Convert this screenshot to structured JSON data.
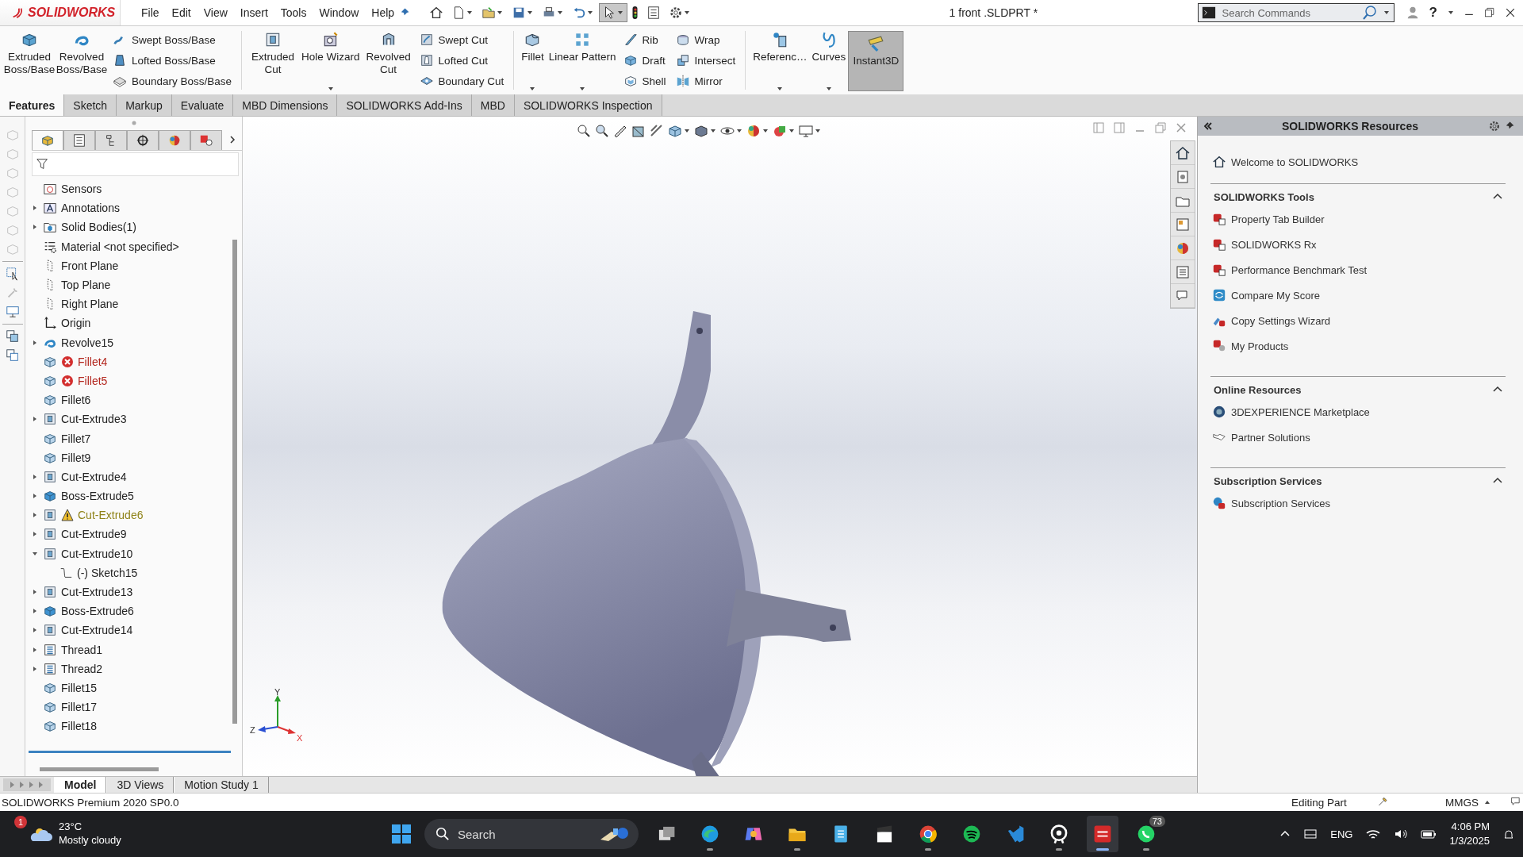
{
  "title_bar": {
    "logo": "SOLIDWORKS",
    "menu": [
      "File",
      "Edit",
      "View",
      "Insert",
      "Tools",
      "Window",
      "Help"
    ],
    "quick_access": [
      {
        "selected": false
      },
      {
        "selected": false
      },
      {
        "selected": false
      },
      {
        "selected": false
      },
      {
        "selected": false
      },
      {
        "selected": false
      },
      {
        "selected": true
      },
      {
        "selected": false
      },
      {
        "selected": false
      },
      {
        "selected": false
      }
    ],
    "document_title": "1 front .SLDPRT *",
    "search": {
      "placeholder": "Search Commands"
    },
    "help": "?"
  },
  "ribbon": {
    "columns": [
      {
        "kind": "large",
        "items": [
          {
            "label": "Extruded Boss/Base",
            "dropdown": false,
            "selected": false
          }
        ]
      },
      {
        "kind": "large",
        "items": [
          {
            "label": "Revolved Boss/Base",
            "dropdown": false,
            "selected": false
          }
        ]
      },
      {
        "kind": "stack",
        "items": [
          {
            "label": "Swept Boss/Base"
          },
          {
            "label": "Lofted Boss/Base"
          },
          {
            "label": "Boundary Boss/Base"
          }
        ]
      },
      {
        "kind": "divider"
      },
      {
        "kind": "large",
        "items": [
          {
            "label": "Extruded Cut",
            "dropdown": false,
            "selected": false
          }
        ]
      },
      {
        "kind": "large",
        "items": [
          {
            "label": "Hole Wizard",
            "dropdown": true,
            "selected": false
          }
        ]
      },
      {
        "kind": "large",
        "items": [
          {
            "label": "Revolved Cut",
            "dropdown": false,
            "selected": false
          }
        ]
      },
      {
        "kind": "stack",
        "items": [
          {
            "label": "Swept Cut"
          },
          {
            "label": "Lofted Cut"
          },
          {
            "label": "Boundary Cut"
          }
        ]
      },
      {
        "kind": "divider"
      },
      {
        "kind": "large",
        "items": [
          {
            "label": "Fillet",
            "dropdown": true,
            "selected": false
          }
        ]
      },
      {
        "kind": "large",
        "items": [
          {
            "label": "Linear Pattern",
            "dropdown": true,
            "selected": false
          }
        ]
      },
      {
        "kind": "stack",
        "items": [
          {
            "label": "Rib"
          },
          {
            "label": "Draft"
          },
          {
            "label": "Shell"
          }
        ]
      },
      {
        "kind": "stack",
        "items": [
          {
            "label": "Wrap"
          },
          {
            "label": "Intersect"
          },
          {
            "label": "Mirror"
          }
        ]
      },
      {
        "kind": "divider"
      },
      {
        "kind": "large",
        "items": [
          {
            "label": "Referenc…",
            "dropdown": true,
            "selected": false
          }
        ]
      },
      {
        "kind": "large",
        "items": [
          {
            "label": "Curves",
            "dropdown": true,
            "selected": false
          }
        ]
      },
      {
        "kind": "large",
        "items": [
          {
            "label": "Instant3D",
            "dropdown": false,
            "selected": true
          }
        ]
      }
    ]
  },
  "command_tabs": [
    {
      "label": "Features",
      "selected": true
    },
    {
      "label": "Sketch",
      "selected": false
    },
    {
      "label": "Markup",
      "selected": false
    },
    {
      "label": "Evaluate",
      "selected": false
    },
    {
      "label": "MBD Dimensions",
      "selected": false
    },
    {
      "label": "SOLIDWORKS Add-Ins",
      "selected": false
    },
    {
      "label": "MBD",
      "selected": false
    },
    {
      "label": "SOLIDWORKS Inspection",
      "selected": false
    }
  ],
  "feature_tree": {
    "panel_tabs": [
      {
        "selected": true
      },
      {
        "selected": false
      },
      {
        "selected": false
      },
      {
        "selected": false
      },
      {
        "selected": false
      },
      {
        "selected": false
      }
    ],
    "items": [
      {
        "label": "Sensors",
        "kind": "sensors"
      },
      {
        "label": "Annotations",
        "kind": "annotations",
        "expanded": false
      },
      {
        "label": "Solid Bodies(1)",
        "kind": "bodies",
        "expanded": false
      },
      {
        "label": "Material <not specified>",
        "kind": "material"
      },
      {
        "label": "Front Plane",
        "kind": "plane"
      },
      {
        "label": "Top Plane",
        "kind": "plane"
      },
      {
        "label": "Right Plane",
        "kind": "plane"
      },
      {
        "label": "Origin",
        "kind": "origin"
      },
      {
        "label": "Revolve15",
        "kind": "revolve",
        "expanded": false
      },
      {
        "label": "Fillet4",
        "kind": "fillet",
        "error": true
      },
      {
        "label": "Fillet5",
        "kind": "fillet",
        "error": true
      },
      {
        "label": "Fillet6",
        "kind": "fillet"
      },
      {
        "label": "Cut-Extrude3",
        "kind": "cut",
        "expanded": false
      },
      {
        "label": "Fillet7",
        "kind": "fillet"
      },
      {
        "label": "Fillet9",
        "kind": "fillet"
      },
      {
        "label": "Cut-Extrude4",
        "kind": "cut",
        "expanded": false
      },
      {
        "label": "Boss-Extrude5",
        "kind": "boss",
        "expanded": false
      },
      {
        "label": "Cut-Extrude6",
        "kind": "cut",
        "expanded": false,
        "warning": true
      },
      {
        "label": "Cut-Extrude9",
        "kind": "cut",
        "expanded": false
      },
      {
        "label": "Cut-Extrude10",
        "kind": "cut",
        "expanded": true,
        "children": [
          {
            "label": "(-) Sketch15",
            "kind": "sketch"
          }
        ]
      },
      {
        "label": "Cut-Extrude13",
        "kind": "cut",
        "expanded": false
      },
      {
        "label": "Boss-Extrude6",
        "kind": "boss",
        "expanded": false
      },
      {
        "label": "Cut-Extrude14",
        "kind": "cut",
        "expanded": false
      },
      {
        "label": "Thread1",
        "kind": "thread",
        "expanded": false
      },
      {
        "label": "Thread2",
        "kind": "thread",
        "expanded": false
      },
      {
        "label": "Fillet15",
        "kind": "fillet"
      },
      {
        "label": "Fillet17",
        "kind": "fillet"
      },
      {
        "label": "Fillet18",
        "kind": "fillet"
      }
    ]
  },
  "viewport": {
    "triad": {
      "x": "X",
      "y": "Y",
      "z": "Z"
    }
  },
  "bottom_tabs": [
    {
      "label": "Model",
      "selected": true
    },
    {
      "label": "3D Views",
      "selected": false
    },
    {
      "label": "Motion Study 1",
      "selected": false
    }
  ],
  "resources": {
    "title": "SOLIDWORKS Resources",
    "welcome": "Welcome to SOLIDWORKS",
    "sections": [
      {
        "title": "SOLIDWORKS Tools",
        "expanded": true,
        "items": [
          "Property Tab Builder",
          "SOLIDWORKS Rx",
          "Performance Benchmark Test",
          "Compare My Score",
          "Copy Settings Wizard",
          "My Products"
        ]
      },
      {
        "title": "Online Resources",
        "expanded": true,
        "items": [
          "3DEXPERIENCE Marketplace",
          "Partner Solutions"
        ]
      },
      {
        "title": "Subscription Services",
        "expanded": true,
        "items": [
          "Subscription Services"
        ]
      }
    ]
  },
  "status_bar": {
    "product": "SOLIDWORKS Premium 2020 SP0.0",
    "mode": "Editing Part",
    "units": "MMGS"
  },
  "taskbar": {
    "weather": {
      "badge": "1",
      "temperature": "23°C",
      "condition": "Mostly cloudy"
    },
    "search": {
      "placeholder": "Search"
    },
    "apps": [
      {
        "running": false,
        "selected": false
      },
      {
        "running": true,
        "selected": false
      },
      {
        "running": false,
        "selected": false
      },
      {
        "running": true,
        "selected": false
      },
      {
        "running": false,
        "selected": false
      },
      {
        "running": false,
        "selected": false
      },
      {
        "running": true,
        "selected": false
      },
      {
        "running": false,
        "selected": false
      },
      {
        "running": false,
        "selected": false
      },
      {
        "running": true,
        "selected": false
      },
      {
        "running": true,
        "selected": true
      },
      {
        "running": true,
        "selected": false,
        "badge": "73"
      }
    ],
    "language": "ENG",
    "time": "4:06 PM",
    "date": "1/3/2025"
  }
}
